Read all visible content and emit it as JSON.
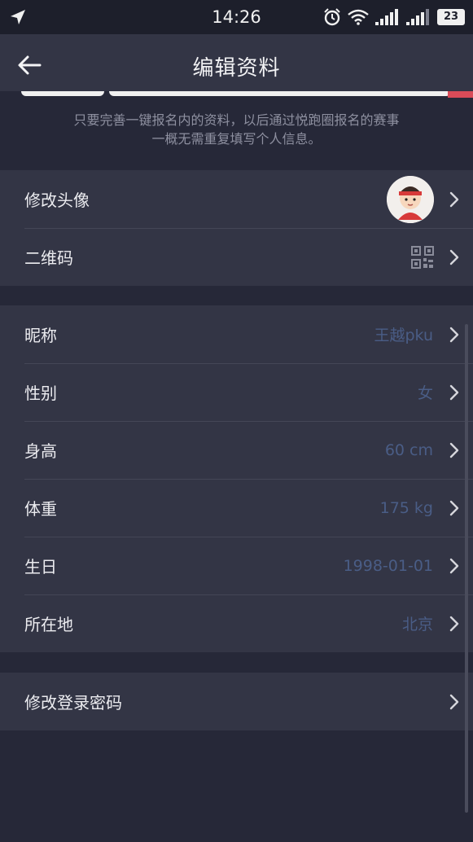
{
  "status_bar": {
    "time": "14:26",
    "battery": "23",
    "icons": [
      "location-arrow-icon",
      "alarm-icon",
      "wifi-icon",
      "signal-icon",
      "signal-icon",
      "battery-icon"
    ]
  },
  "header": {
    "title": "编辑资料",
    "back_icon": "back-arrow-icon"
  },
  "notice": {
    "line1": "只要完善一键报名内的资料，以后通过悦跑圈报名的赛事",
    "line2": "一概无需重复填写个人信息。"
  },
  "profile_group": {
    "avatar_label": "修改头像",
    "qrcode_label": "二维码"
  },
  "info_group": {
    "items": [
      {
        "label": "昵称",
        "value": "王越pku"
      },
      {
        "label": "性别",
        "value": "女"
      },
      {
        "label": "身高",
        "value": "60 cm"
      },
      {
        "label": "体重",
        "value": "175 kg"
      },
      {
        "label": "生日",
        "value": "1998-01-01"
      },
      {
        "label": "所在地",
        "value": "北京"
      }
    ]
  },
  "password_group": {
    "label": "修改登录密码"
  },
  "colors": {
    "background": "#262838",
    "card": "#333545",
    "value_text": "#4a5d86",
    "accent_red": "#d94b58"
  }
}
